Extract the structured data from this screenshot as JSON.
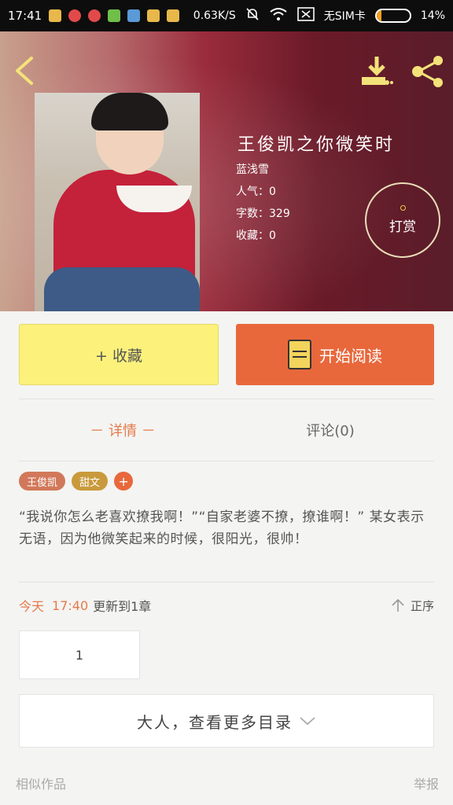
{
  "status_bar": {
    "time": "17:41",
    "net_speed": "0.63K/S",
    "sim": "无SIM卡",
    "battery": "14%",
    "battery_level": 0.14
  },
  "book": {
    "title": "王俊凯之你微笑时",
    "author": "蓝浅雪",
    "popularity": "人气：0",
    "word_count": "字数：329",
    "favorites": "收藏：0",
    "reward_label": "打赏"
  },
  "actions": {
    "favorite_label": "+ 收藏",
    "read_label": "开始阅读"
  },
  "tabs": [
    {
      "label": "－ 详情 －"
    },
    {
      "label": "评论(0)"
    }
  ],
  "tags": [
    {
      "label": "王俊凯",
      "color": "#d2785a"
    },
    {
      "label": "甜文",
      "color": "#c99a3c"
    },
    {
      "label": "+",
      "color": "#e8683c"
    }
  ],
  "synopsis": "“我说你怎么老喜欢撩我啊！”“自家老婆不撩，撩谁啊！” 某女表示无语，因为他微笑起来的时候，很阳光，很帅！",
  "update": {
    "today": "今天",
    "time": "17:40",
    "text": "更新到1章",
    "sort_label": "正序"
  },
  "chapters": [
    "1"
  ],
  "more_label": "大人，查看更多目录",
  "footer": {
    "similar": "相似作品",
    "report": "举报"
  },
  "colors": {
    "accent": "#e8683c",
    "favorite_bg": "#fbf17b",
    "download_icon": "#f3e27a"
  }
}
